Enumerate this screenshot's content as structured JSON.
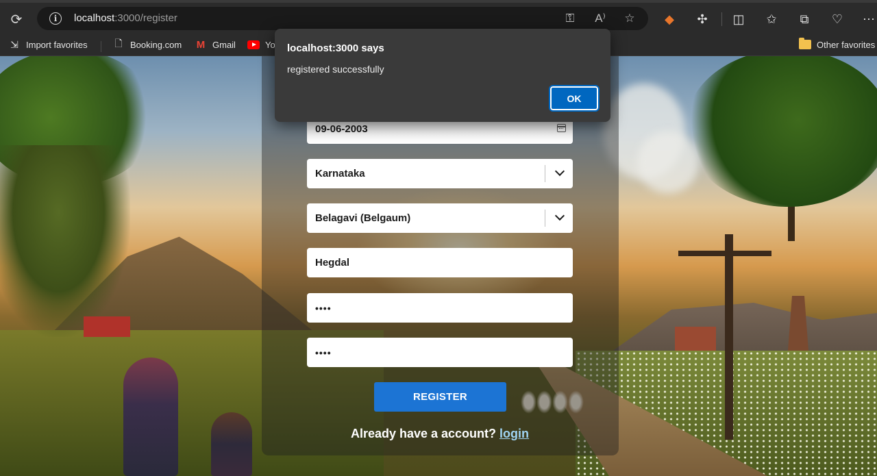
{
  "browser": {
    "url_host": "localhost",
    "url_path": ":3000/register",
    "toolbar_icons": [
      "refresh-icon",
      "info-icon",
      "key-icon",
      "read-aloud-icon",
      "favorite-star-icon",
      "metamask-fox-icon",
      "extensions-icon",
      "split-screen-icon",
      "favorites-icon",
      "collections-icon",
      "browser-essentials-icon",
      "more-icon"
    ]
  },
  "favorites_bar": {
    "items": [
      {
        "label": "Import favorites",
        "icon": "import-icon"
      },
      {
        "label": "Booking.com",
        "icon": "page-icon"
      },
      {
        "label": "Gmail",
        "icon": "gmail-icon"
      },
      {
        "label": "Yo",
        "icon": "youtube-icon"
      }
    ],
    "other": {
      "label": "Other favorites",
      "icon": "folder-icon"
    }
  },
  "form": {
    "date": "09-06-2003",
    "state": "Karnataka",
    "district": "Belagavi (Belgaum)",
    "village": "Hegdal",
    "password": "••••",
    "confirm_password": "••••",
    "register_label": "REGISTER",
    "account_prompt": "Already have a account? ",
    "login_label": "login"
  },
  "dialog": {
    "title": "localhost:3000 says",
    "message": "registered successfully",
    "ok_label": "OK"
  },
  "colors": {
    "accent": "#1c74d4",
    "dialog_button": "#0067c0",
    "link": "#9fd3f2"
  }
}
